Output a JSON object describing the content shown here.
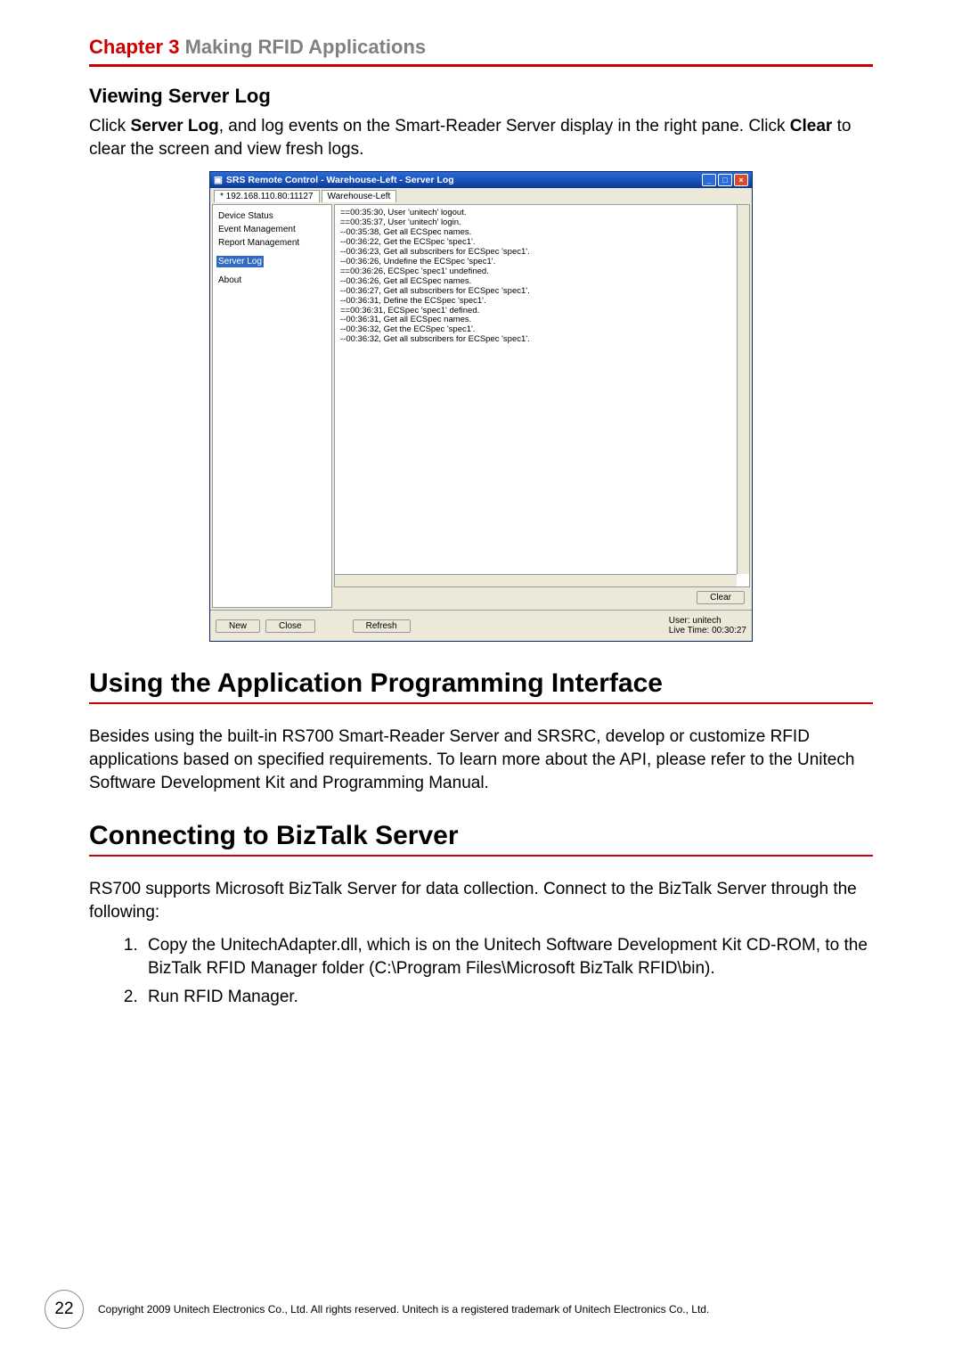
{
  "chapter": {
    "label": "Chapter 3",
    "title": "Making RFID Applications"
  },
  "section_viewing": {
    "heading": "Viewing Server Log",
    "para_pre": "Click ",
    "bold1": "Server Log",
    "para_mid": ", and log events on the Smart-Reader Server display in the right pane. Click ",
    "bold2": "Clear",
    "para_post": " to clear the screen and view fresh logs."
  },
  "window": {
    "title": "SRS Remote Control - Warehouse-Left - Server Log",
    "tabs": [
      "* 192.168.110.80:11127",
      "Warehouse-Left"
    ],
    "sidebar": {
      "items": [
        "Device Status",
        "Event Management",
        "Report Management",
        "Server Log",
        "About"
      ],
      "selected_index": 3
    },
    "log_lines": [
      "==00:35:30, User 'unitech' logout.",
      "==00:35:37, User 'unitech' login.",
      "--00:35:38, Get all ECSpec names.",
      "--00:36:22, Get the ECSpec 'spec1'.",
      "--00:36:23, Get all subscribers for ECSpec 'spec1'.",
      "--00:36:26, Undefine the ECSpec 'spec1'.",
      "==00:36:26, ECSpec 'spec1' undefined.",
      "--00:36:26, Get all ECSpec names.",
      "--00:36:27, Get all subscribers for ECSpec 'spec1'.",
      "--00:36:31, Define the ECSpec 'spec1'.",
      "==00:36:31, ECSpec 'spec1' defined.",
      "--00:36:31, Get all ECSpec names.",
      "--00:36:32, Get the ECSpec 'spec1'.",
      "--00:36:32, Get all subscribers for ECSpec 'spec1'."
    ],
    "buttons": {
      "clear": "Clear",
      "new": "New",
      "close": "Close",
      "refresh": "Refresh"
    },
    "footer": {
      "user_line": "User: unitech",
      "time_line": "Live Time: 00:30:27"
    }
  },
  "section_api": {
    "heading": "Using the Application Programming Interface",
    "para": "Besides using the built-in RS700 Smart-Reader Server and SRSRC, develop or customize RFID applications based on specified requirements. To learn more about the API, please refer to the Unitech Software Development Kit and Programming Manual."
  },
  "section_biztalk": {
    "heading": "Connecting to BizTalk Server",
    "para": "RS700 supports Microsoft BizTalk Server for data collection. Connect to the BizTalk Server through the following:",
    "steps": [
      "Copy the UnitechAdapter.dll, which is on the Unitech Software Development Kit CD-ROM, to the BizTalk RFID Manager folder (C:\\Program Files\\Microsoft BizTalk RFID\\bin).",
      "Run RFID Manager."
    ]
  },
  "footer": {
    "page": "22",
    "copyright": "Copyright 2009 Unitech Electronics Co., Ltd. All rights reserved. Unitech is a registered trademark of Unitech Electronics Co., Ltd."
  }
}
